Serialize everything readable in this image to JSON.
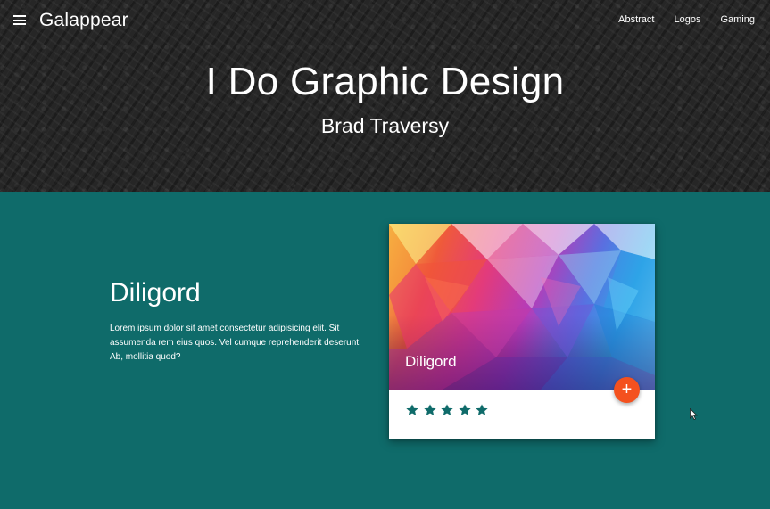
{
  "nav": {
    "brand": "Galappear",
    "links": [
      "Abstract",
      "Logos",
      "Gaming"
    ]
  },
  "hero": {
    "title": "I Do Graphic Design",
    "subtitle": "Brad Traversy"
  },
  "section": {
    "title": "Diligord",
    "text": "Lorem ipsum dolor sit amet consectetur adipisicing elit. Sit assumenda rem eius quos. Vel cumque reprehenderit deserunt. Ab, mollitia quod?"
  },
  "card": {
    "title": "Diligord",
    "fab_icon": "plus-icon",
    "rating": {
      "value": 5,
      "max": 5
    }
  },
  "colors": {
    "background": "#0f6b6a",
    "header": "#262626",
    "accent": "#f4511e",
    "star": "#0f6b6a"
  }
}
